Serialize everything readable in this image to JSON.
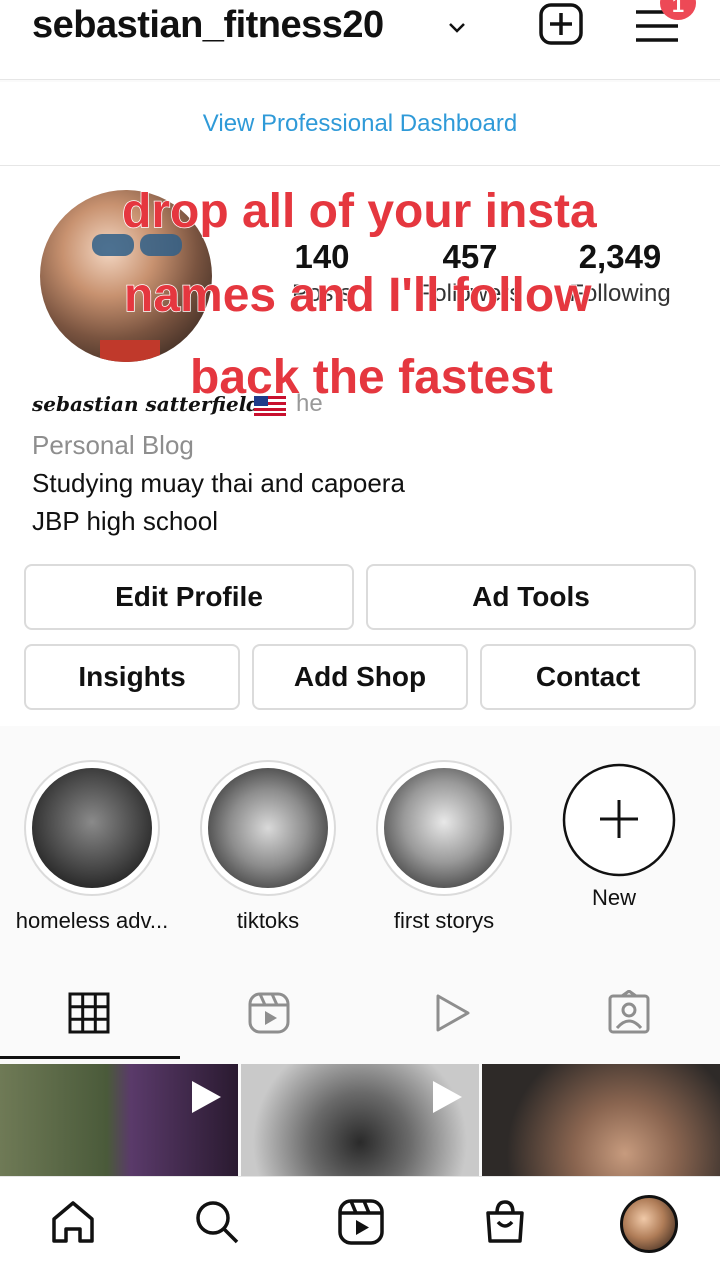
{
  "header": {
    "username": "sebastian_fitness20",
    "notification_count": "1"
  },
  "dashboard_link": "View Professional Dashboard",
  "stats": [
    {
      "value": "140",
      "label": "Posts"
    },
    {
      "value": "457",
      "label": "Followers"
    },
    {
      "value": "2,349",
      "label": "Following"
    }
  ],
  "overlay_caption": {
    "line1": "drop all of your insta",
    "line2": "names and I'll follow",
    "line3": "back the fastest"
  },
  "profile": {
    "full_name": "sebastian satterfield",
    "pronoun": "he",
    "category": "Personal Blog",
    "bio_line1": "Studying muay thai and capoera",
    "bio_line2": "JBP high school"
  },
  "buttons": {
    "edit_profile": "Edit Profile",
    "ad_tools": "Ad Tools",
    "insights": "Insights",
    "add_shop": "Add Shop",
    "contact": "Contact"
  },
  "highlights": [
    {
      "label": "homeless adv..."
    },
    {
      "label": "tiktoks"
    },
    {
      "label": "first storys"
    },
    {
      "label": "New"
    }
  ],
  "colors": {
    "link_blue": "#2f9ad8",
    "overlay_red": "#e5373f",
    "badge_red": "#ed4956"
  }
}
